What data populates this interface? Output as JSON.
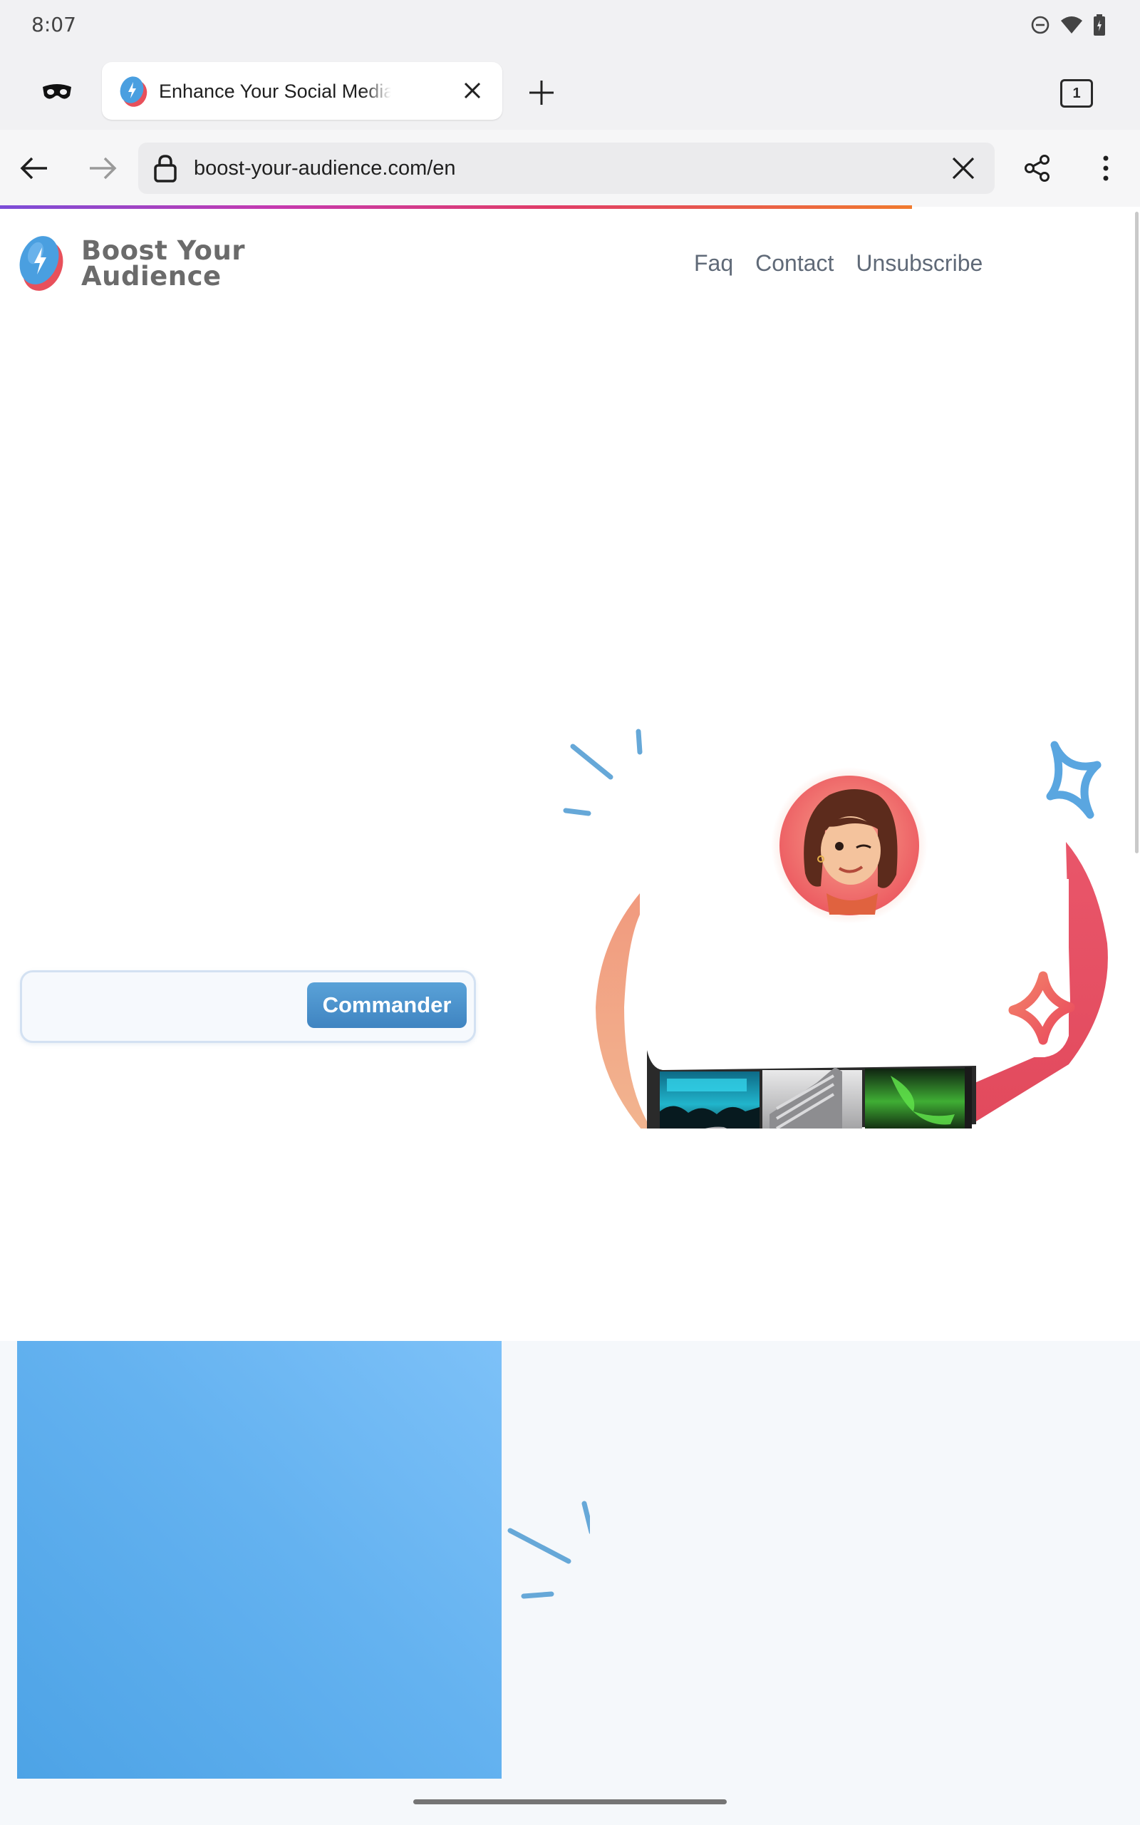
{
  "status_bar": {
    "time": "8:07",
    "icons": [
      "do-not-disturb-icon",
      "wifi-icon",
      "battery-icon"
    ]
  },
  "browser": {
    "tab": {
      "title": "Enhance Your Social Media Growth",
      "favicon": "boost-your-audience-favicon"
    },
    "tab_count": "1",
    "url": "boost-your-audience.com/en",
    "load_progress": 0.8
  },
  "site": {
    "logo": {
      "line1": "Boost Your",
      "line2": "Audience"
    },
    "nav": {
      "faq": "Faq",
      "contact": "Contact",
      "unsubscribe": "Unsubscribe"
    },
    "order_form": {
      "input_placeholder": "",
      "button_label": "Commander"
    }
  },
  "colors": {
    "brand_blue": "#4a9fe0",
    "brand_red": "#e8505b",
    "button_blue": "#4a8fcc",
    "nav_text": "#606a78"
  }
}
